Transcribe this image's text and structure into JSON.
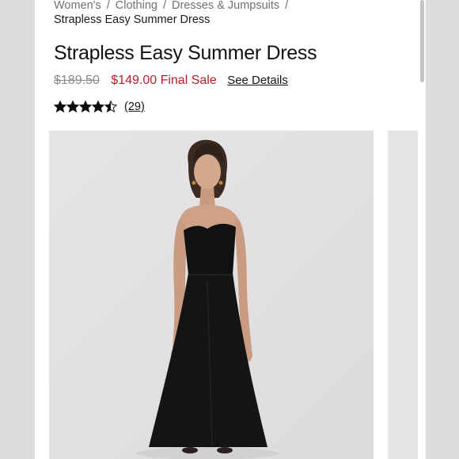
{
  "breadcrumb": {
    "items": [
      "Women's",
      "Clothing",
      "Dresses & Jumpsuits"
    ],
    "separator": "/",
    "current": "Strapless Easy Summer Dress"
  },
  "product": {
    "title": "Strapless Easy Summer Dress",
    "original_price": "$189.50",
    "sale_price": "$149.00 Final Sale",
    "details_link": "See Details",
    "rating": 4.5,
    "rating_max": 5,
    "review_count": "(29)",
    "image_icon": "product-photo-black-strapless-midi-dress"
  },
  "colors": {
    "sale": "#b3202b",
    "strikethrough": "#8a8a8a",
    "gallery_bg": "#e3e1e3",
    "frame": "#dcdcde"
  }
}
